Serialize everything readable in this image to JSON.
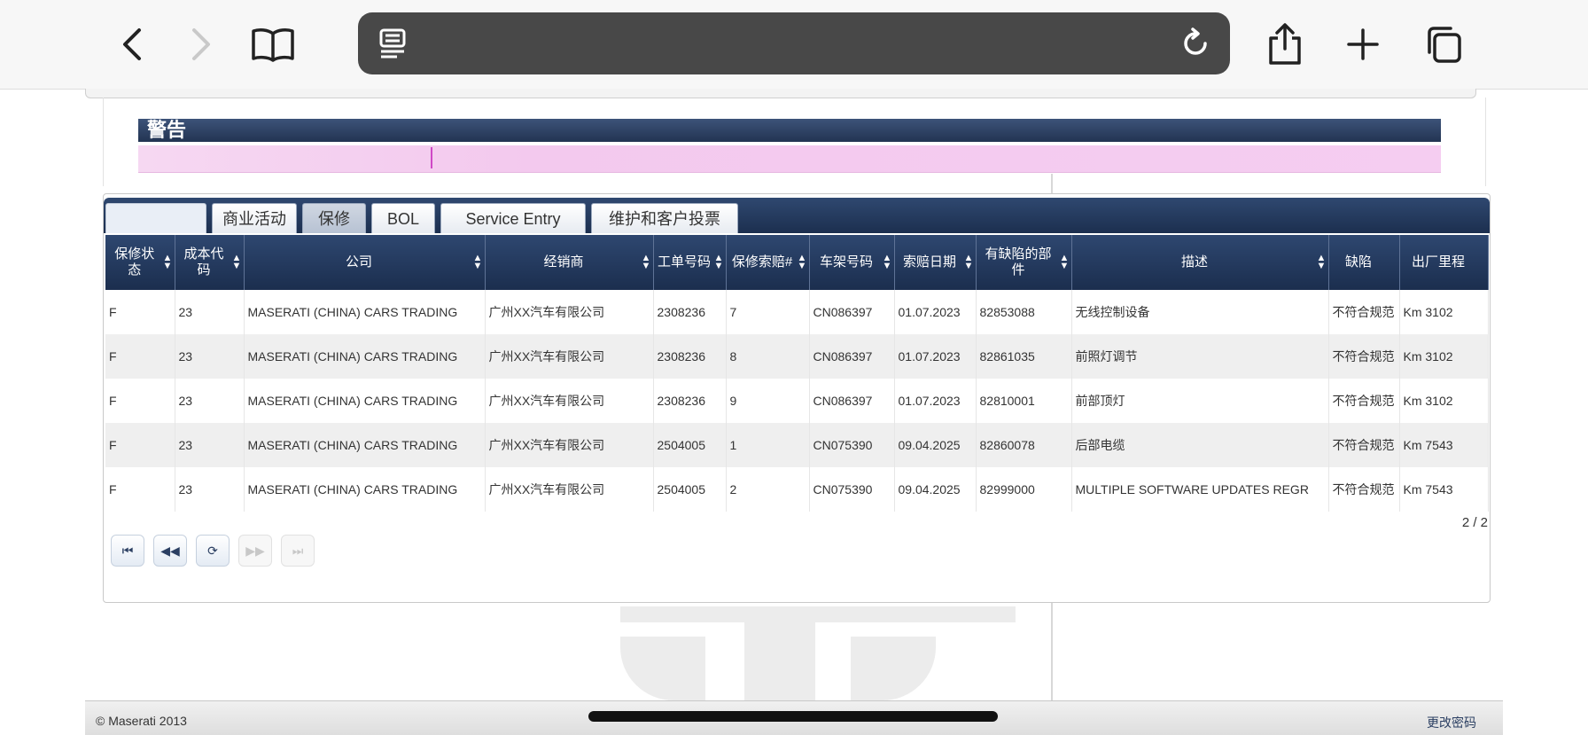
{
  "browser": {
    "url": "",
    "icons": {
      "back": "chevron-left-icon",
      "forward": "chevron-right-icon",
      "bookmarks": "book-icon",
      "reader": "reader-icon",
      "reload": "reload-icon",
      "share": "share-icon",
      "new_tab": "plus-icon",
      "tabs": "tabs-icon"
    }
  },
  "alert": {
    "title": "警告"
  },
  "tabs": [
    {
      "label": ""
    },
    {
      "label": "商业活动"
    },
    {
      "label": "保修"
    },
    {
      "label": "BOL"
    },
    {
      "label": "Service Entry"
    },
    {
      "label": "维护和客户投票"
    }
  ],
  "table": {
    "columns": [
      "保修状态",
      "成本代码",
      "公司",
      "经销商",
      "工单号码",
      "保修索赔#",
      "车架号码",
      "索赔日期",
      "有缺陷的部件",
      "描述",
      "缺陷",
      "出厂里程"
    ],
    "rows": [
      [
        "F",
        "23",
        "MASERATI (CHINA) CARS TRADING",
        "广州XX汽车有限公司",
        "2308236",
        "7",
        "CN086397",
        "01.07.2023",
        "82853088",
        "无线控制设备",
        "不符合规范",
        "Km 3102"
      ],
      [
        "F",
        "23",
        "MASERATI (CHINA) CARS TRADING",
        "广州XX汽车有限公司",
        "2308236",
        "8",
        "CN086397",
        "01.07.2023",
        "82861035",
        "前照灯调节",
        "不符合规范",
        "Km 3102"
      ],
      [
        "F",
        "23",
        "MASERATI (CHINA) CARS TRADING",
        "广州XX汽车有限公司",
        "2308236",
        "9",
        "CN086397",
        "01.07.2023",
        "82810001",
        "前部顶灯",
        "不符合规范",
        "Km 3102"
      ],
      [
        "F",
        "23",
        "MASERATI (CHINA) CARS TRADING",
        "广州XX汽车有限公司",
        "2504005",
        "1",
        "CN075390",
        "09.04.2025",
        "82860078",
        "后部电缆",
        "不符合规范",
        "Km 7543"
      ],
      [
        "F",
        "23",
        "MASERATI (CHINA) CARS TRADING",
        "广州XX汽车有限公司",
        "2504005",
        "2",
        "CN075390",
        "09.04.2025",
        "82999000",
        "MULTIPLE SOFTWARE UPDATES REGR",
        "不符合规范",
        "Km 7543"
      ]
    ]
  },
  "pager": {
    "info": "2 / 2",
    "buttons": [
      {
        "symbol": "⏮",
        "name": "first-page-button",
        "enabled": true
      },
      {
        "symbol": "◀◀",
        "name": "prev-page-button",
        "enabled": true
      },
      {
        "symbol": "⟳",
        "name": "refresh-button",
        "enabled": true
      },
      {
        "symbol": "▶▶",
        "name": "next-page-button",
        "enabled": false
      },
      {
        "symbol": "⏭",
        "name": "last-page-button",
        "enabled": false
      }
    ]
  },
  "footer": {
    "copyright": "© Maserati 2013",
    "change_password": "更改密码"
  }
}
